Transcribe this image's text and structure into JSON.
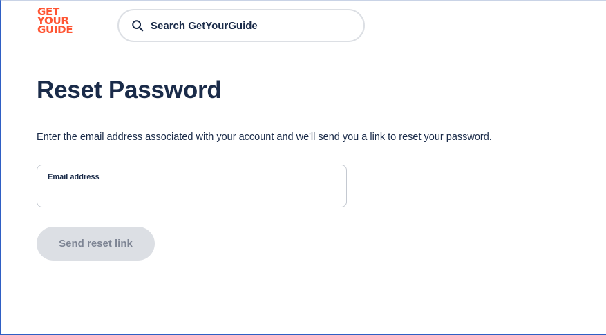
{
  "header": {
    "logo_lines": [
      "GET",
      "YOUR",
      "GUIDE"
    ],
    "search": {
      "placeholder": "Search GetYourGuide",
      "icon": "search-icon"
    }
  },
  "main": {
    "title": "Reset Password",
    "instructions": "Enter the email address associated with your account and we'll send you a link to reset your password.",
    "email_field": {
      "label": "Email address",
      "value": ""
    },
    "send_button": {
      "label": "Send reset link",
      "disabled": true
    }
  },
  "colors": {
    "brand": "#ff5533",
    "text": "#1a2b49",
    "button_disabled_bg": "#dcdfe4",
    "button_disabled_text": "#7e8594",
    "border": "#c4c9d1"
  }
}
